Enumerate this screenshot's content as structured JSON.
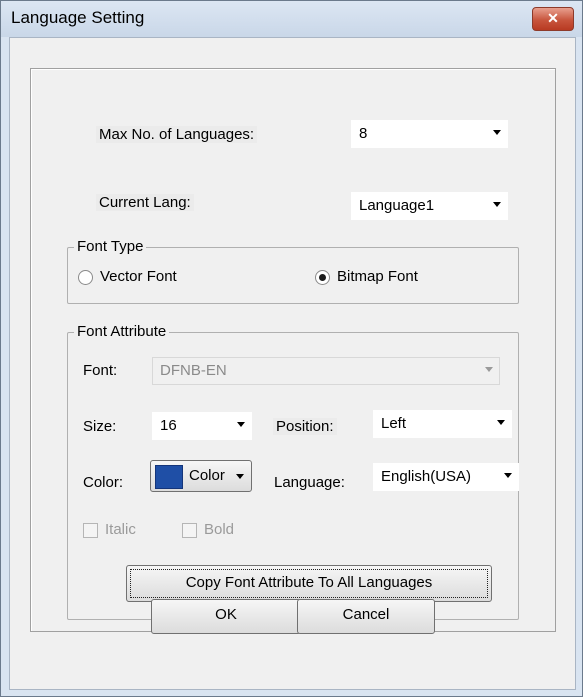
{
  "window": {
    "title": "Language Setting",
    "close_glyph": "✕"
  },
  "max_languages": {
    "label": "Max No. of Languages:",
    "value": "8"
  },
  "current_lang": {
    "label": "Current Lang:",
    "value": "Language1"
  },
  "font_type": {
    "title": "Font Type",
    "options": [
      {
        "label": "Vector Font",
        "checked": false
      },
      {
        "label": "Bitmap Font",
        "checked": true
      }
    ]
  },
  "font_attribute": {
    "title": "Font Attribute",
    "font_label": "Font:",
    "font_value": "DFNB-EN",
    "size_label": "Size:",
    "size_value": "16",
    "position_label": "Position:",
    "position_value": "Left",
    "color_label": "Color:",
    "color_button_label": "Color",
    "color_value": "#1f4fa6",
    "language_label": "Language:",
    "language_value": "English(USA)",
    "italic_label": "Italic",
    "bold_label": "Bold",
    "copy_button_label": "Copy Font Attribute To All Languages"
  },
  "buttons": {
    "ok": "OK",
    "cancel": "Cancel"
  }
}
